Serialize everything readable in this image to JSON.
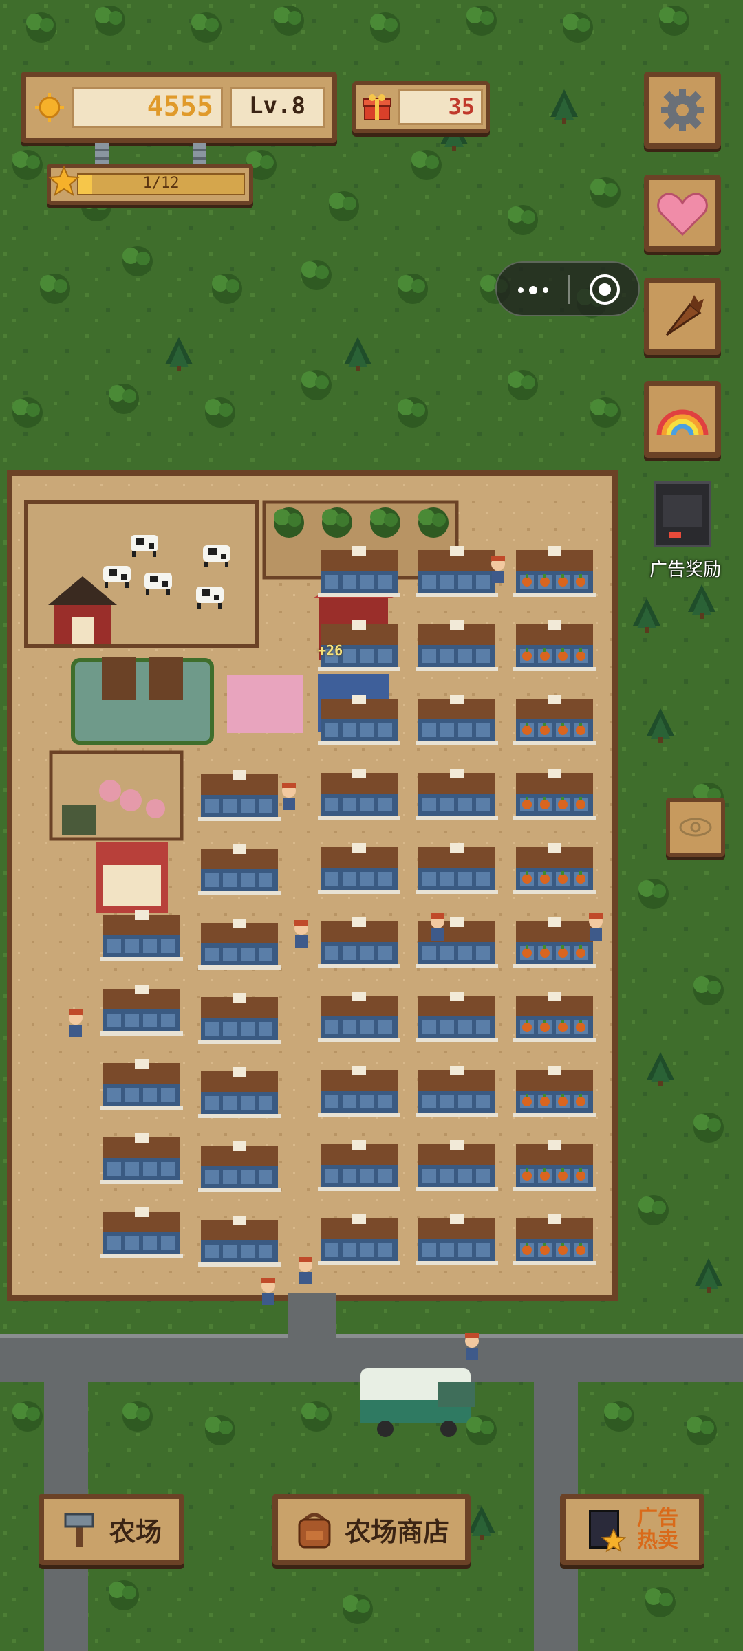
{
  "hud": {
    "coins": "4555",
    "level": "Lv.8",
    "gifts": "35",
    "star_progress": "1/12",
    "star_fraction": 0.0833
  },
  "ad_reward": {
    "label": "广告奖励"
  },
  "floating_reward": "+26",
  "bottom_bar": {
    "farm_label": "农场",
    "shop_label": "农场商店",
    "ad_hot_line1": "广告",
    "ad_hot_line2": "热卖"
  },
  "colors": {
    "grass": "#3c6b2a",
    "dirt": "#c9a777",
    "panel": "#c9a26a",
    "panel_border": "#6b4226",
    "coin_text": "#e09a2a",
    "gift_text": "#c0392b"
  },
  "icons": [
    "sun-coin-icon",
    "gift-icon",
    "star-icon",
    "gear-icon",
    "heart-love-icon",
    "carrot-icon",
    "rainbow-icon",
    "hammer-icon",
    "backpack-icon",
    "ad-book-icon"
  ]
}
